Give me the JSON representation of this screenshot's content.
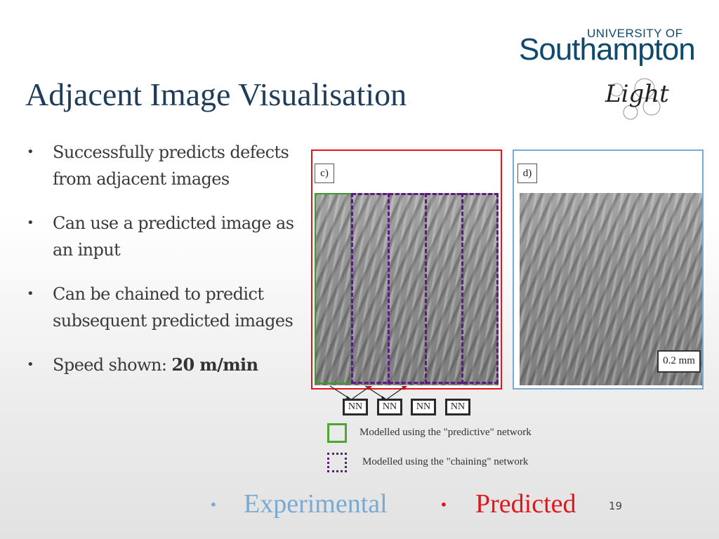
{
  "slide": {
    "title": "Adjacent Image Visualisation",
    "page_number": "19"
  },
  "logo": {
    "university_of": "UNIVERSITY OF",
    "southampton": "Southampton",
    "light": "Light"
  },
  "bullets": [
    {
      "text": "Successfully predicts defects from adjacent images"
    },
    {
      "text": "Can use a predicted image as an input"
    },
    {
      "text": "Can be chained to predict subsequent predicted images"
    },
    {
      "prefix": "Speed shown: ",
      "bold": "20 m/min"
    }
  ],
  "bullet_symbol": "•",
  "figure": {
    "panel_c_label": "c)",
    "panel_d_label": "d)",
    "scale_bar": "0.2 mm",
    "nn_boxes": [
      "NN",
      "NN",
      "NN",
      "NN"
    ],
    "legend": [
      {
        "text": "Modelled using the \"predictive\" network",
        "color": "#4aa830",
        "style": "solid"
      },
      {
        "text": "Modelled using the \"chaining\" network",
        "color": "#5a1a80",
        "style": "dotted"
      }
    ]
  },
  "key": {
    "experimental": {
      "label": "Experimental",
      "color": "#7aaad2"
    },
    "predicted": {
      "label": "Predicted",
      "color": "#e8141c"
    }
  }
}
